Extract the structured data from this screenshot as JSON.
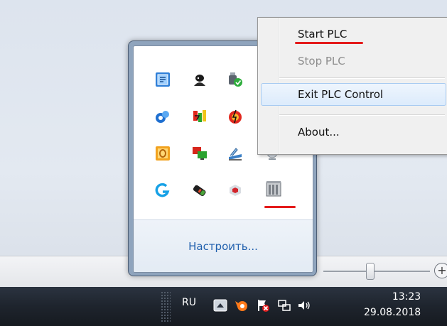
{
  "context_menu": {
    "items": [
      {
        "label": "Start PLC",
        "enabled": true
      },
      {
        "label": "Stop PLC",
        "enabled": false
      },
      {
        "label": "Exit PLC Control",
        "enabled": true
      },
      {
        "label": "About...",
        "enabled": true
      }
    ]
  },
  "tray_flyout": {
    "customize_link": "Настроить...",
    "icons": [
      "sandbox-icon",
      "spy-icon",
      "usb-safely-remove-icon",
      "empty-slot",
      "crosscloud-icon",
      "energy-icon",
      "antivirus-icon",
      "empty-slot",
      "outlook-icon",
      "remote-desktop-icon",
      "scanner-icon",
      "webcam-icon",
      "logitech-g-icon",
      "tablet-icon",
      "hex-cube-icon",
      "plc-control-icon"
    ]
  },
  "taskbar": {
    "language": "RU",
    "clock_time": "13:23",
    "clock_date": "29.08.2018",
    "tray_icons": [
      "show-hidden-icons-arrow-icon",
      "avast-icon",
      "action-center-flag-icon",
      "network-icon",
      "volume-icon"
    ]
  },
  "colors": {
    "annotation_underline": "#e41b1b",
    "menu_hover_border": "#a8cbf1",
    "link": "#1f5fad"
  }
}
